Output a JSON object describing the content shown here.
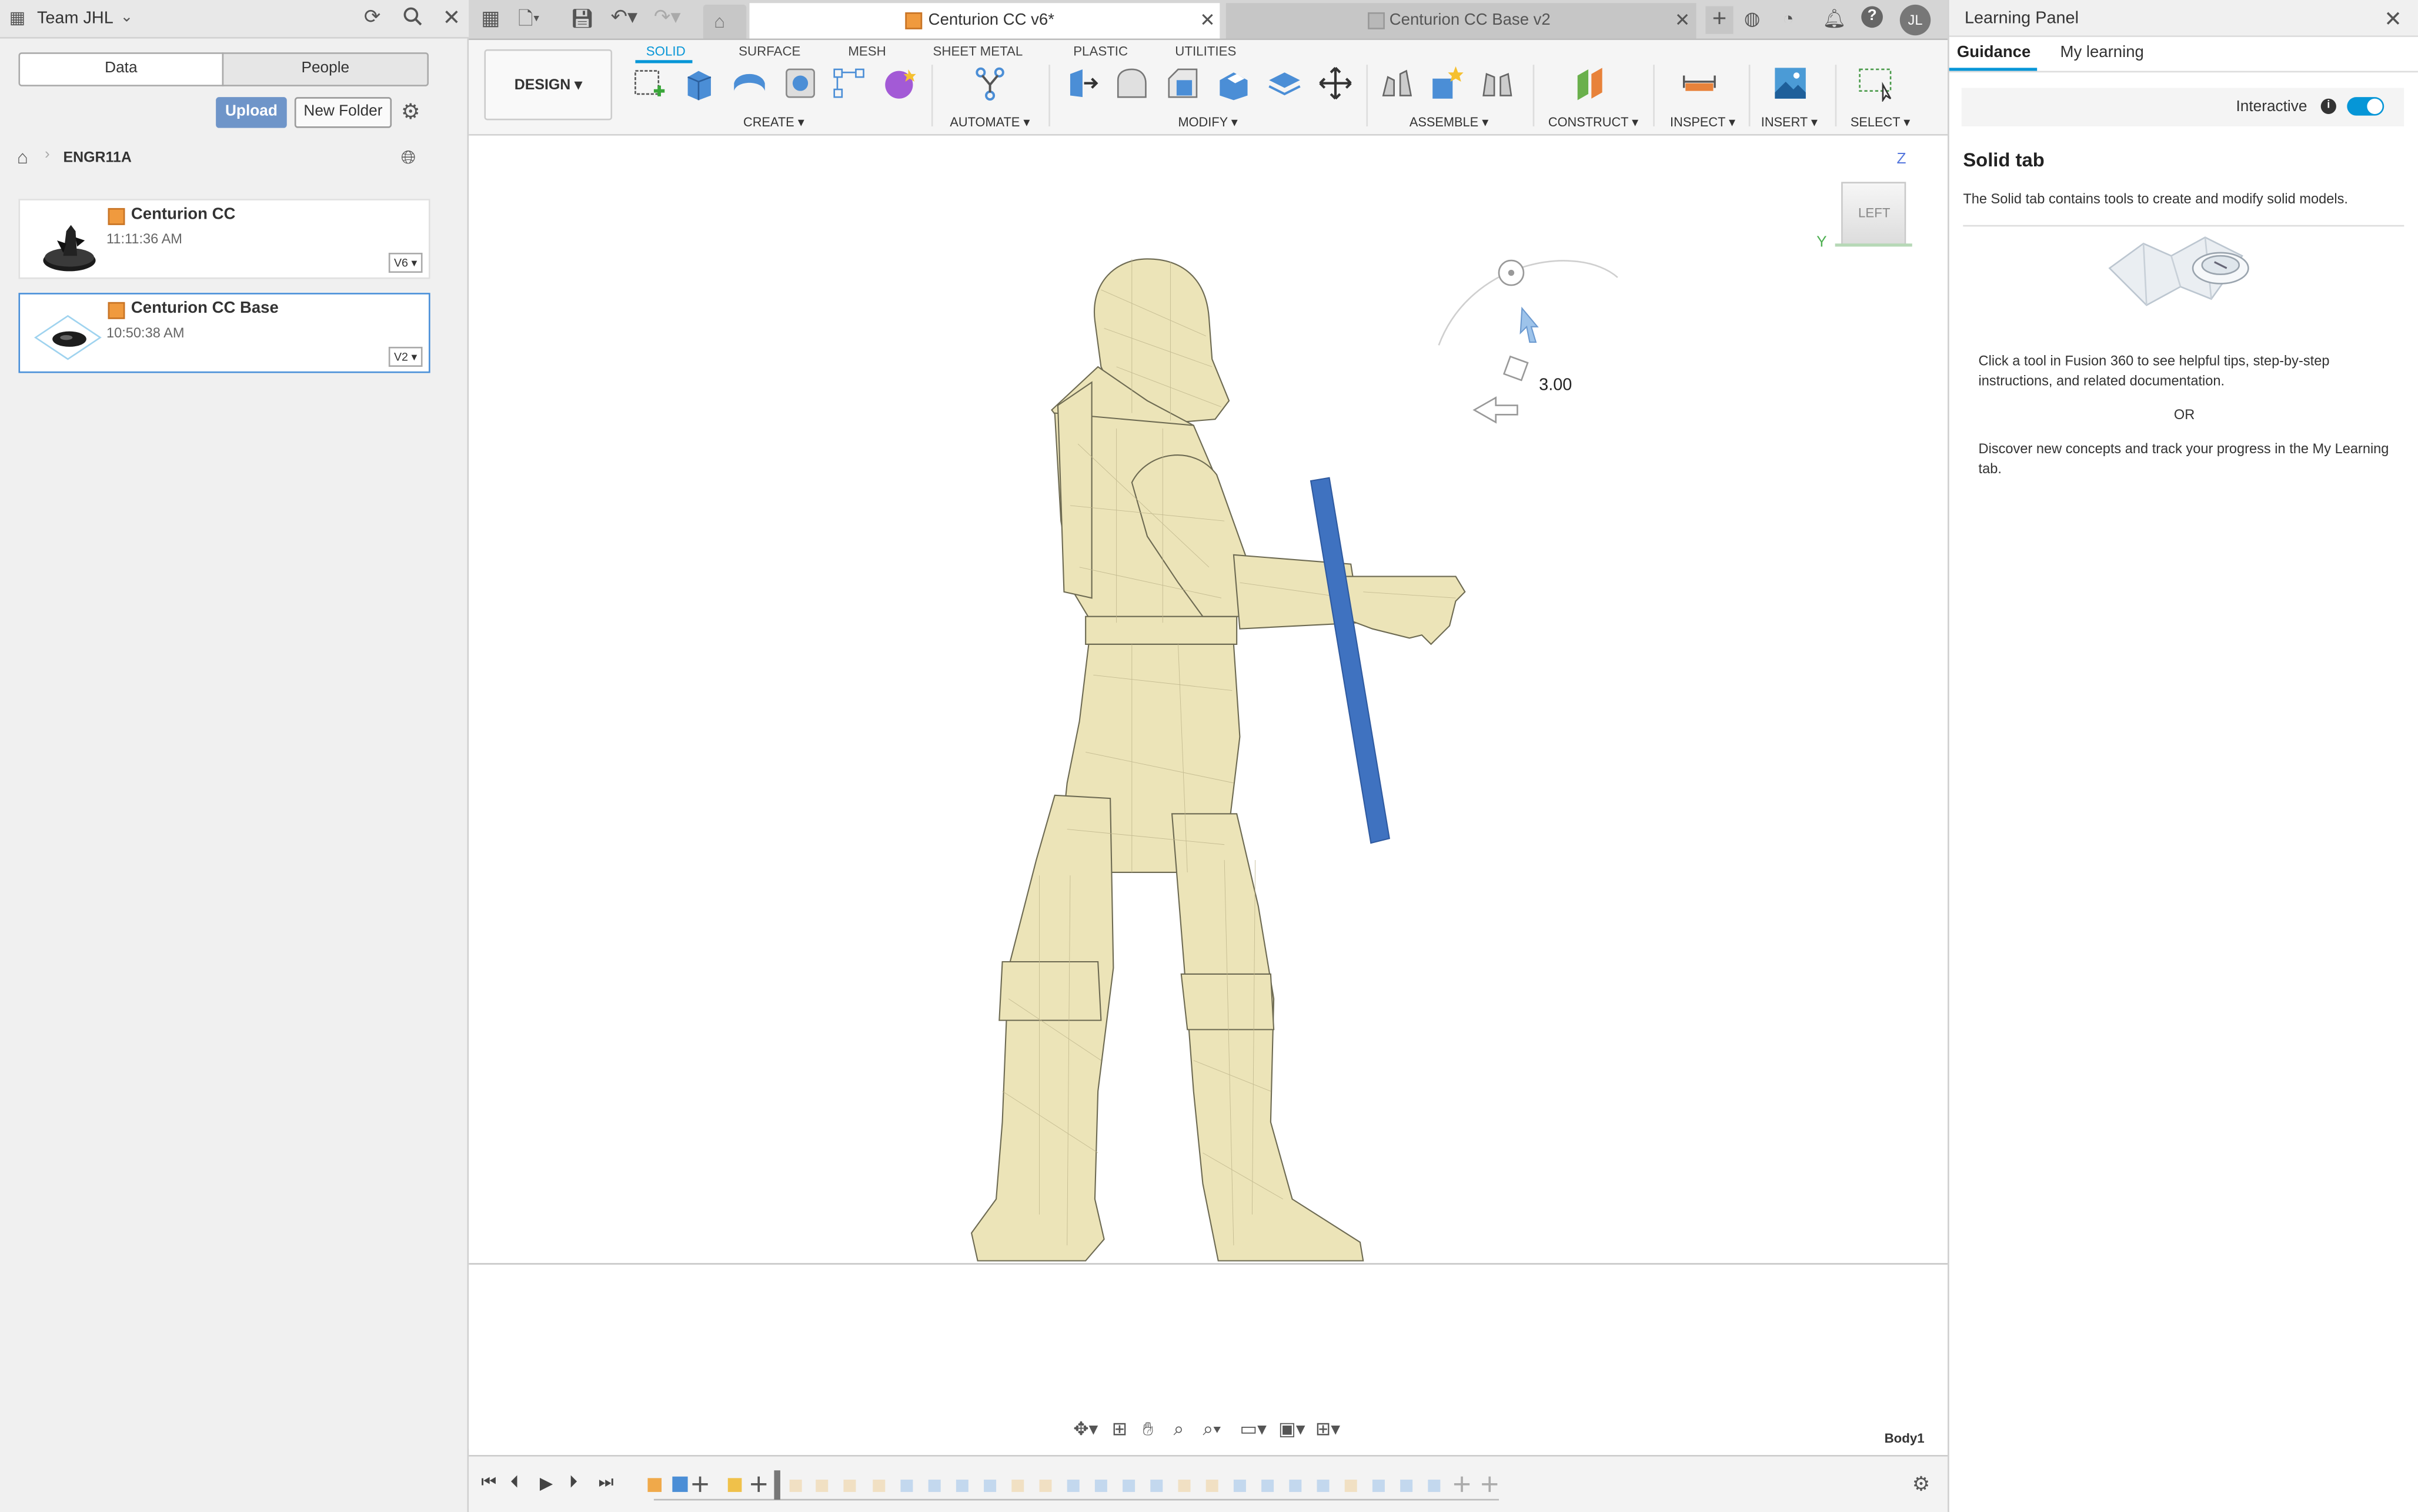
{
  "data_panel": {
    "team": "Team JHL",
    "tabs": [
      "Data",
      "People"
    ],
    "upload_label": "Upload",
    "new_folder_label": "New Folder",
    "breadcrumb": "ENGR11A",
    "files": [
      {
        "name": "Centurion CC",
        "time": "11:11:36 AM",
        "version": "V6",
        "icon": "cube-icon"
      },
      {
        "name": "Centurion CC Base",
        "time": "10:50:38 AM",
        "version": "V2",
        "icon": "cube-icon"
      }
    ]
  },
  "doc_tabs": [
    {
      "title": "Centurion CC v6*",
      "active": true
    },
    {
      "title": "Centurion CC Base v2",
      "active": false
    }
  ],
  "ribbon": {
    "workspace": "DESIGN",
    "tabs": [
      "SOLID",
      "SURFACE",
      "MESH",
      "SHEET METAL",
      "PLASTIC",
      "UTILITIES"
    ],
    "active_tab": "SOLID",
    "groups": [
      "CREATE",
      "AUTOMATE",
      "MODIFY",
      "ASSEMBLE",
      "CONSTRUCT",
      "INSERT",
      "INSPECT",
      "SELECT"
    ]
  },
  "viewport": {
    "view_cube_face": "LEFT",
    "axis_z": "Z",
    "axis_y": "Y",
    "dimension_value": "3.00",
    "body_label": "Body1"
  },
  "learning_panel": {
    "title": "Learning Panel",
    "tabs": [
      "Guidance",
      "My learning"
    ],
    "interactive_label": "Interactive",
    "interactive_on": true,
    "heading": "Solid tab",
    "intro": "The Solid tab contains tools to create and modify solid models.",
    "tip1": "Click a tool in Fusion 360 to see helpful tips, step-by-step instructions, and related documentation.",
    "or": "OR",
    "tip2": "Discover new concepts and track your progress in the My Learning tab."
  },
  "user_initials": "JL",
  "colors": {
    "accent": "#0696d7",
    "upload": "#6f95c9",
    "model": "#ece4b8",
    "bar": "#3f72c0"
  }
}
